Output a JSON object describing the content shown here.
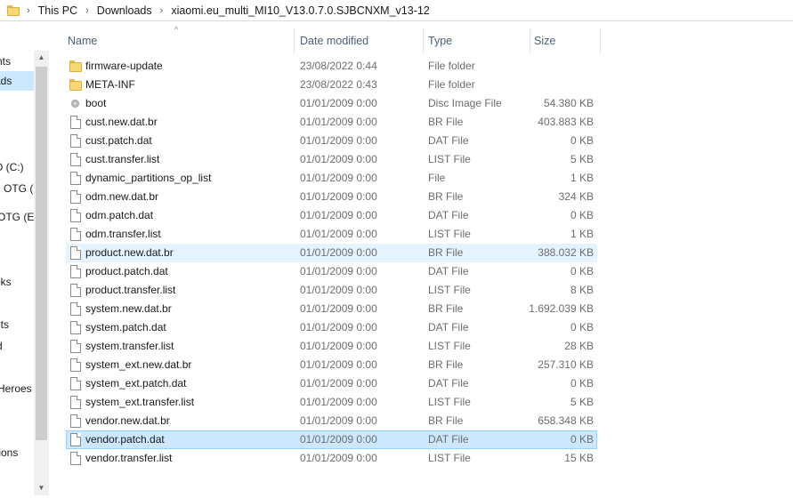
{
  "address_bar": {
    "crumbs": [
      "This PC",
      "Downloads",
      "xiaomi.eu_multi_MI10_V13.0.7.0.SJBCNXM_v13-12"
    ]
  },
  "nav_pane": {
    "items": [
      {
        "label": "nts"
      },
      {
        "label": "ads"
      },
      {
        "label": "O (C:)"
      },
      {
        "label": "OTG (E"
      },
      {
        "label": "OTG (E:)"
      },
      {
        "label": "oks"
      },
      {
        "label": "nts"
      },
      {
        "label": "d"
      },
      {
        "label": "Heroes ("
      },
      {
        "label": "tions"
      }
    ]
  },
  "columns": {
    "name": "Name",
    "date": "Date modified",
    "type": "Type",
    "size": "Size"
  },
  "files": [
    {
      "name": "firmware-update",
      "date": "23/08/2022 0:44",
      "type": "File folder",
      "size": "",
      "icon": "folder"
    },
    {
      "name": "META-INF",
      "date": "23/08/2022 0:43",
      "type": "File folder",
      "size": "",
      "icon": "folder"
    },
    {
      "name": "boot",
      "date": "01/01/2009 0:00",
      "type": "Disc Image File",
      "size": "54.380 KB",
      "icon": "disc"
    },
    {
      "name": "cust.new.dat.br",
      "date": "01/01/2009 0:00",
      "type": "BR File",
      "size": "403.883 KB",
      "icon": "file"
    },
    {
      "name": "cust.patch.dat",
      "date": "01/01/2009 0:00",
      "type": "DAT File",
      "size": "0 KB",
      "icon": "file"
    },
    {
      "name": "cust.transfer.list",
      "date": "01/01/2009 0:00",
      "type": "LIST File",
      "size": "5 KB",
      "icon": "file"
    },
    {
      "name": "dynamic_partitions_op_list",
      "date": "01/01/2009 0:00",
      "type": "File",
      "size": "1 KB",
      "icon": "file"
    },
    {
      "name": "odm.new.dat.br",
      "date": "01/01/2009 0:00",
      "type": "BR File",
      "size": "324 KB",
      "icon": "file"
    },
    {
      "name": "odm.patch.dat",
      "date": "01/01/2009 0:00",
      "type": "DAT File",
      "size": "0 KB",
      "icon": "file"
    },
    {
      "name": "odm.transfer.list",
      "date": "01/01/2009 0:00",
      "type": "LIST File",
      "size": "1 KB",
      "icon": "file"
    },
    {
      "name": "product.new.dat.br",
      "date": "01/01/2009 0:00",
      "type": "BR File",
      "size": "388.032 KB",
      "icon": "file",
      "state": "hover"
    },
    {
      "name": "product.patch.dat",
      "date": "01/01/2009 0:00",
      "type": "DAT File",
      "size": "0 KB",
      "icon": "file"
    },
    {
      "name": "product.transfer.list",
      "date": "01/01/2009 0:00",
      "type": "LIST File",
      "size": "8 KB",
      "icon": "file"
    },
    {
      "name": "system.new.dat.br",
      "date": "01/01/2009 0:00",
      "type": "BR File",
      "size": "1.692.039 KB",
      "icon": "file"
    },
    {
      "name": "system.patch.dat",
      "date": "01/01/2009 0:00",
      "type": "DAT File",
      "size": "0 KB",
      "icon": "file"
    },
    {
      "name": "system.transfer.list",
      "date": "01/01/2009 0:00",
      "type": "LIST File",
      "size": "28 KB",
      "icon": "file"
    },
    {
      "name": "system_ext.new.dat.br",
      "date": "01/01/2009 0:00",
      "type": "BR File",
      "size": "257.310 KB",
      "icon": "file"
    },
    {
      "name": "system_ext.patch.dat",
      "date": "01/01/2009 0:00",
      "type": "DAT File",
      "size": "0 KB",
      "icon": "file"
    },
    {
      "name": "system_ext.transfer.list",
      "date": "01/01/2009 0:00",
      "type": "LIST File",
      "size": "5 KB",
      "icon": "file"
    },
    {
      "name": "vendor.new.dat.br",
      "date": "01/01/2009 0:00",
      "type": "BR File",
      "size": "658.348 KB",
      "icon": "file"
    },
    {
      "name": "vendor.patch.dat",
      "date": "01/01/2009 0:00",
      "type": "DAT File",
      "size": "0 KB",
      "icon": "file",
      "state": "selected"
    },
    {
      "name": "vendor.transfer.list",
      "date": "01/01/2009 0:00",
      "type": "LIST File",
      "size": "15 KB",
      "icon": "file"
    }
  ]
}
